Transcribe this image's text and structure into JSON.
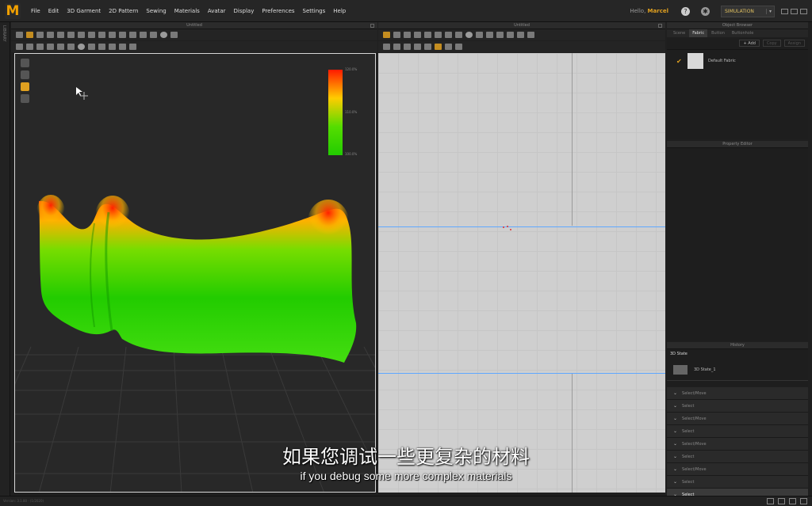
{
  "menubar": {
    "logo": "M",
    "items": [
      "File",
      "Edit",
      "3D Garment",
      "2D Pattern",
      "Sewing",
      "Materials",
      "Avatar",
      "Display",
      "Preferences",
      "Settings",
      "Help"
    ],
    "user_prefix": "Hello,",
    "user_name": "Marcel",
    "help_icon": "question-icon",
    "mode_label": "SIMULATION"
  },
  "left_rail": {
    "label": "LIBRARY"
  },
  "view3d": {
    "title": "Untitled",
    "legend": {
      "top": "120.0%",
      "mid": "110.0%",
      "bottom": "100.0%"
    },
    "colors": {
      "high": "#ff1a00",
      "mid": "#ffcc00",
      "low": "#22cc00"
    }
  },
  "view2d": {
    "title": "Untitled"
  },
  "object_browser": {
    "title": "Object Browser",
    "tabs": [
      "Scene",
      "Fabric",
      "Button",
      "Buttonhole"
    ],
    "active_tab": "Fabric",
    "add_label": "+ Add",
    "copy_label": "Copy",
    "assign_label": "Assign",
    "fabric_name": "Default Fabric"
  },
  "property_editor": {
    "title": "Property Editor"
  },
  "history": {
    "title": "History",
    "state_title": "3D State",
    "state_name": "3D State_1",
    "items": [
      "Select/Move",
      "Select",
      "Select/Move",
      "Select",
      "Select/Move",
      "Select",
      "Select/Move",
      "Select",
      "Select"
    ]
  },
  "status": {
    "text": "Version: 3.1.80 · (1/2020)"
  },
  "subtitles": {
    "zh": "如果您调试一些更复杂的材料",
    "en": "if you debug some more complex materials"
  }
}
